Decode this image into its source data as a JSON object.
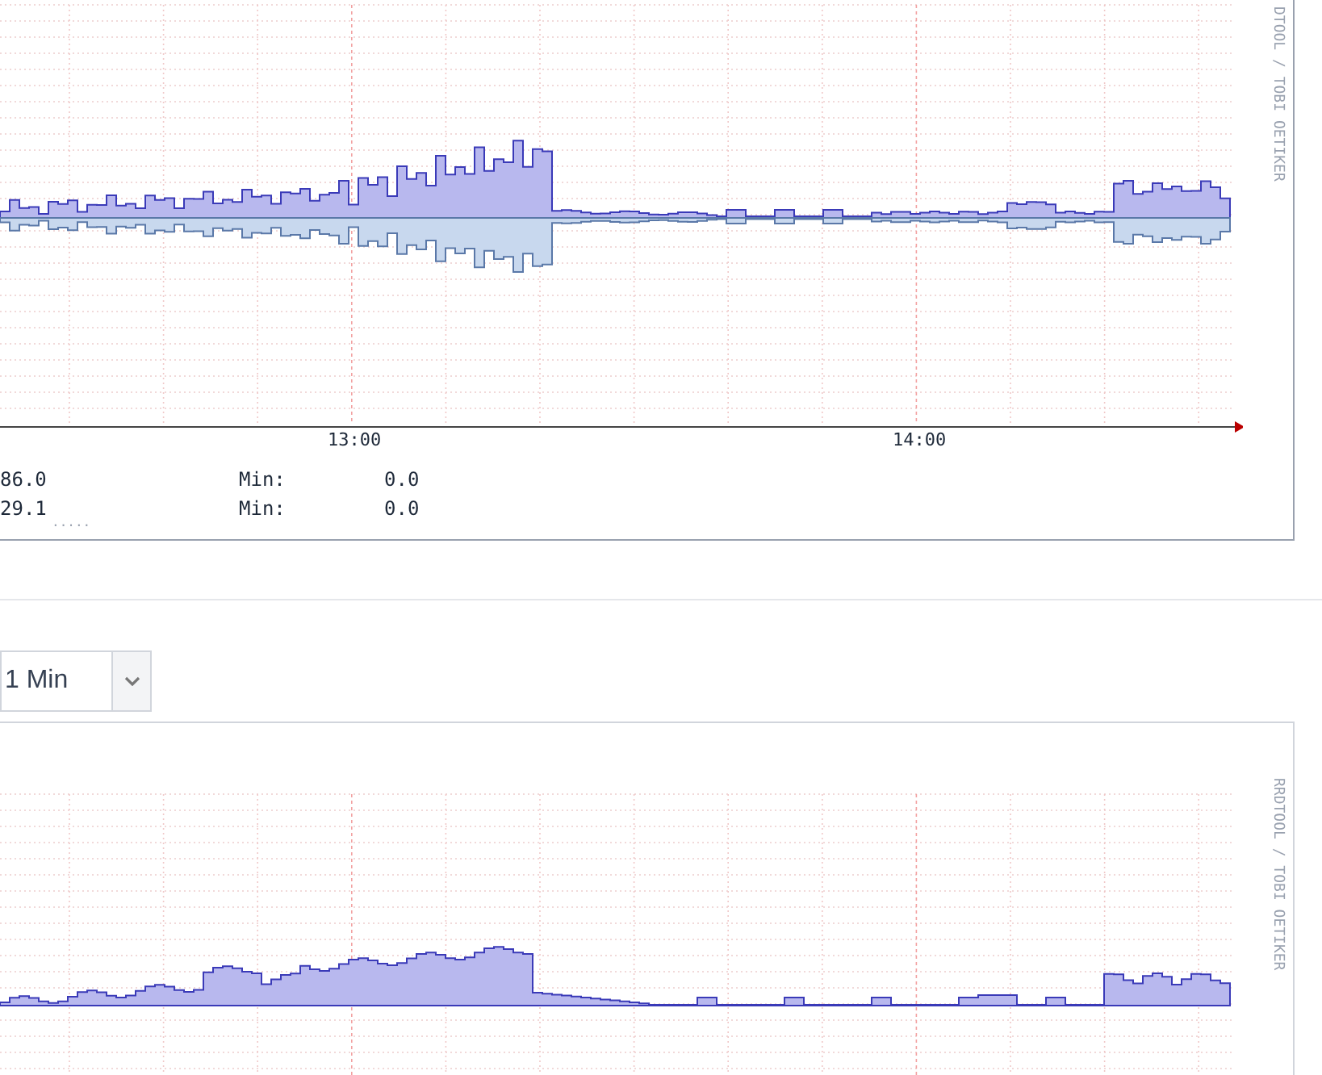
{
  "graphs": [
    {
      "x_tick_labels": [
        "13:00",
        "14:00"
      ],
      "credit": "DTOOL / TOBI OETIKER",
      "legend": [
        {
          "value": "86.0",
          "min_label": "Min:",
          "min_value": "0.0"
        },
        {
          "value": "29.1",
          "min_label": "Min:",
          "min_value": "0.0"
        }
      ],
      "more": "....."
    },
    {
      "credit": "RRDTOOL / TOBI OETIKER"
    }
  ],
  "interval_select": {
    "value": "1 Min"
  }
}
